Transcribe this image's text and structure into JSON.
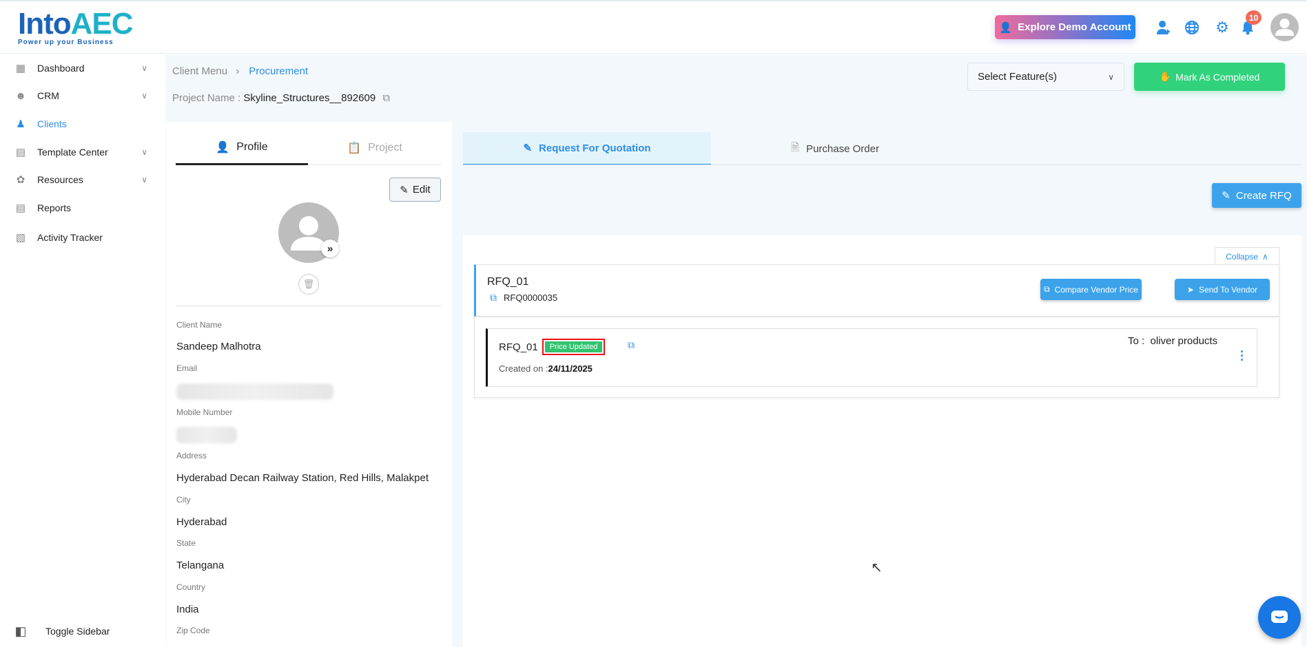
{
  "header": {
    "logo_main": "Into",
    "logo_accent": "AEC",
    "logo_tagline": "Power up your Business",
    "demo_button": "Explore Demo Account",
    "notification_count": "10"
  },
  "sidebar": {
    "items": [
      {
        "label": "Dashboard",
        "icon": "dashboard-icon",
        "has_chevron": true
      },
      {
        "label": "CRM",
        "icon": "crm-icon",
        "has_chevron": true
      },
      {
        "label": "Clients",
        "icon": "clients-icon",
        "active": true
      },
      {
        "label": "Template Center",
        "icon": "template-icon",
        "has_chevron": true
      },
      {
        "label": "Resources",
        "icon": "resources-icon",
        "has_chevron": true
      },
      {
        "label": "Reports",
        "icon": "reports-icon"
      },
      {
        "label": "Activity Tracker",
        "icon": "activity-icon"
      }
    ],
    "toggle": "Toggle Sidebar"
  },
  "breadcrumb": {
    "parent": "Client Menu",
    "current": "Procurement"
  },
  "project": {
    "label": "Project Name :",
    "value": "Skyline_Structures__892609"
  },
  "toolbar": {
    "feature_select": "Select Feature(s)",
    "mark_completed": "Mark As Completed"
  },
  "profile": {
    "tabs": [
      "Profile",
      "Project"
    ],
    "edit": "Edit",
    "fields": [
      {
        "label": "Client Name",
        "value": "Sandeep Malhotra"
      },
      {
        "label": "Email"
      },
      {
        "label": "Mobile Number"
      },
      {
        "label": "Address",
        "value": "Hyderabad Decan Railway Station, Red Hills, Malakpet"
      },
      {
        "label": "City",
        "value": "Hyderabad"
      },
      {
        "label": "State",
        "value": "Telangana"
      },
      {
        "label": "Country",
        "value": "India"
      },
      {
        "label": "Zip Code"
      }
    ]
  },
  "procurement": {
    "tabs": [
      "Request For Quotation",
      "Purchase Order"
    ],
    "create_button": "Create RFQ",
    "collapse": "Collapse",
    "rfq": {
      "title": "RFQ_01",
      "code": "RFQ0000035",
      "compare_button": "Compare Vendor Price",
      "send_button": "Send To Vendor",
      "item": {
        "title": "RFQ_01",
        "status": "Price Updated",
        "created_label": "Created on :",
        "created_date": "24/11/2025",
        "to_label": "To :",
        "vendor": "oliver products"
      }
    }
  },
  "colors": {
    "accent": "#2d8ee6",
    "success": "#31d27c",
    "badge": "#f06a5a"
  }
}
